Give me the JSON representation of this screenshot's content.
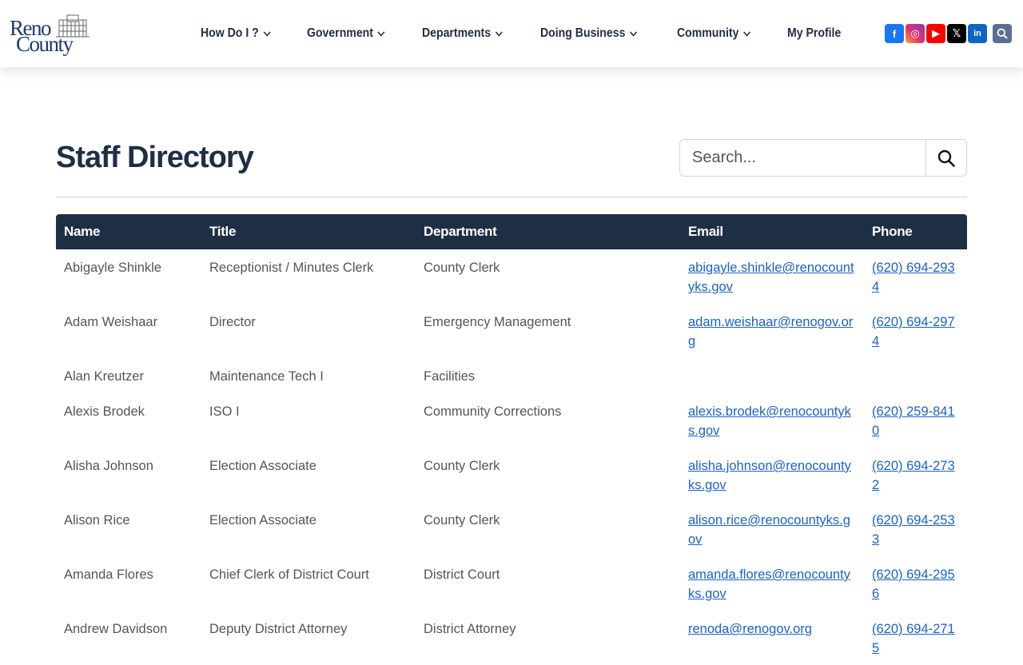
{
  "header": {
    "logo_line1": "Reno",
    "logo_line2": "County",
    "nav": [
      {
        "label": "How Do I ?",
        "has_dropdown": true
      },
      {
        "label": "Government",
        "has_dropdown": true
      },
      {
        "label": "Departments",
        "has_dropdown": true
      },
      {
        "label": "Doing Business",
        "has_dropdown": true
      },
      {
        "label": "Community",
        "has_dropdown": true
      },
      {
        "label": "My Profile",
        "has_dropdown": false
      }
    ],
    "socials": [
      {
        "icon": "facebook-icon",
        "glyph": "f"
      },
      {
        "icon": "instagram-icon",
        "glyph": "◎"
      },
      {
        "icon": "youtube-icon",
        "glyph": "▶"
      },
      {
        "icon": "x-icon",
        "glyph": "𝕏"
      },
      {
        "icon": "linkedin-icon",
        "glyph": "in"
      }
    ]
  },
  "page": {
    "title": "Staff Directory",
    "search_placeholder": "Search..."
  },
  "table": {
    "columns": [
      "Name",
      "Title",
      "Department",
      "Email",
      "Phone"
    ],
    "rows": [
      {
        "name": "Abigayle Shinkle",
        "title": "Receptionist / Minutes Clerk",
        "department": "County Clerk",
        "email": "abigayle.shinkle@renocountyks.gov",
        "phone": "(620) 694-2934"
      },
      {
        "name": "Adam Weishaar",
        "title": "Director",
        "department": "Emergency Management",
        "email": "adam.weishaar@renogov.org",
        "phone": "(620) 694-2974"
      },
      {
        "name": "Alan Kreutzer",
        "title": "Maintenance Tech I",
        "department": "Facilities",
        "email": "",
        "phone": ""
      },
      {
        "name": "Alexis Brodek",
        "title": "ISO I",
        "department": "Community Corrections",
        "email": "alexis.brodek@renocountyks.gov",
        "phone": "(620) 259-8410"
      },
      {
        "name": "Alisha Johnson",
        "title": "Election Associate",
        "department": "County Clerk",
        "email": "alisha.johnson@renocountyks.gov",
        "phone": "(620) 694-2732"
      },
      {
        "name": "Alison Rice",
        "title": "Election Associate",
        "department": "County Clerk",
        "email": "alison.rice@renocountyks.gov",
        "phone": "(620) 694-2533"
      },
      {
        "name": "Amanda Flores",
        "title": "Chief Clerk of District Court",
        "department": "District Court",
        "email": "amanda.flores@renocountyks.gov",
        "phone": "(620) 694-2956"
      },
      {
        "name": "Andrew Davidson",
        "title": "Deputy District Attorney",
        "department": "District Attorney",
        "email": "renoda@renogov.org",
        "phone": "(620) 694-2715"
      }
    ]
  }
}
